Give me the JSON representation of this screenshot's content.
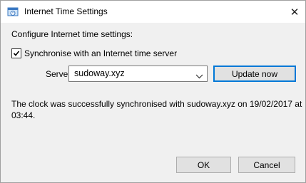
{
  "window": {
    "title": "Internet Time Settings",
    "icon": "clock-settings-icon"
  },
  "form": {
    "heading": "Configure Internet time settings:",
    "sync_checkbox": {
      "label": "Synchronise with an Internet time server",
      "checked": true
    },
    "server_label": "Server:",
    "server_value": "sudoway.xyz",
    "update_button": "Update now",
    "status_text": "The clock was successfully synchronised with sudoway.xyz on 19/02/2017 at 03:44."
  },
  "buttons": {
    "ok": "OK",
    "cancel": "Cancel"
  },
  "colors": {
    "accent": "#0078d7",
    "button_bg": "#e1e1e1",
    "dialog_bg": "#f0f0f0"
  }
}
